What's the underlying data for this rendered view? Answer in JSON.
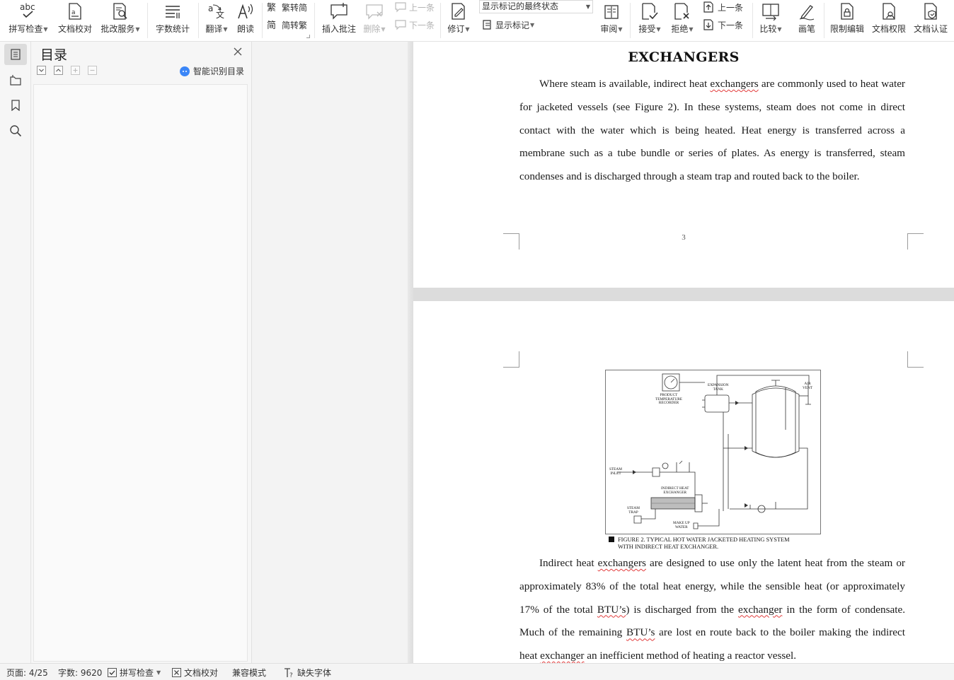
{
  "ribbon": {
    "spell_check": "拼写检查",
    "doc_proof": "文档校对",
    "revise_service": "批改服务",
    "word_count": "字数统计",
    "translate": "翻译",
    "read_aloud": "朗读",
    "to_simplified": "繁转简",
    "to_traditional": "简转繁",
    "insert_comment": "插入批注",
    "delete": "删除",
    "prev_comment": "上一条",
    "next_comment": "下一条",
    "track_changes": "修订",
    "markup_state": "显示标记的最终状态",
    "show_markup": "显示标记",
    "review_pane": "审阅",
    "accept": "接受",
    "reject": "拒绝",
    "prev_change": "上一条",
    "next_change": "下一条",
    "compare": "比较",
    "ink": "画笔",
    "restrict_edit": "限制编辑",
    "doc_permission": "文档权限",
    "doc_certify": "文档认证",
    "abc_label": "abc",
    "icon_names": [
      "spellcheck-icon",
      "doc-proof-icon",
      "revise-icon",
      "word-count-icon",
      "translate-icon",
      "read-aloud-icon",
      "comment-icon",
      "track-changes-icon",
      "accept-icon",
      "reject-icon",
      "compare-icon",
      "pen-icon",
      "lock-icon"
    ]
  },
  "sidebar": {
    "title": "目录",
    "ai_toc": "智能识别目录",
    "rail_icons": [
      "toc-icon",
      "navigation-icon",
      "bookmark-icon",
      "search-icon"
    ]
  },
  "document": {
    "page1": {
      "heading": "EXCHANGERS",
      "para_parts": [
        "Where steam is available, indirect heat ",
        "exchangers",
        " are commonly used to heat water for jacketed vessels (see Figure 2). In these systems, steam does not come in direct contact with the water which is being heated. Heat energy is transferred across a membrane such as a tube bundle or series of plates. As energy is transferred, steam condenses and is discharged through a steam trap and routed back to the boiler."
      ],
      "page_number": "3"
    },
    "page2": {
      "figure_labels": {
        "recorder": [
          "PRODUCT",
          "TEMPERATURE",
          "RECORDER"
        ],
        "expansion": [
          "EXPANSION",
          "TANK"
        ],
        "vent": [
          "AIR",
          "VENT"
        ],
        "steam_inlet": [
          "STEAM",
          "INLET"
        ],
        "exchanger": [
          "INDIRECT HEAT",
          "EXCHANGER"
        ],
        "steam_trap": [
          "STEAM",
          "TRAP"
        ],
        "makeup": [
          "MAKE UP",
          "WATER"
        ]
      },
      "caption_line1": "FIGURE 2. TYPICAL HOT WATER JACKETED HEATING SYSTEM",
      "caption_line2": "WITH INDIRECT HEAT EXCHANGER.",
      "para_parts": [
        "Indirect heat ",
        "exchangers",
        " are designed to use only the latent heat from the steam or approximately 83% of the total heat energy, while the sensible heat (or approximately 17% of the total ",
        "BTU’s",
        ") is discharged from the ",
        "exchanger",
        " in the form of condensate. Much of the remaining ",
        "BTU’s",
        " are lost en route back to the boiler making the indirect heat ",
        "exchanger",
        " an inefficient method of heating a reactor vessel."
      ]
    }
  },
  "status": {
    "page": "页面: 4/25",
    "words": "字数: 9620",
    "spell": "拼写检查",
    "proof": "文档校对",
    "compat": "兼容模式",
    "missing_font": "缺失字体"
  },
  "colors": {
    "accent": "#3b86f7",
    "squiggle": "#e23b3b",
    "gray_bg": "#f6f6f6"
  }
}
